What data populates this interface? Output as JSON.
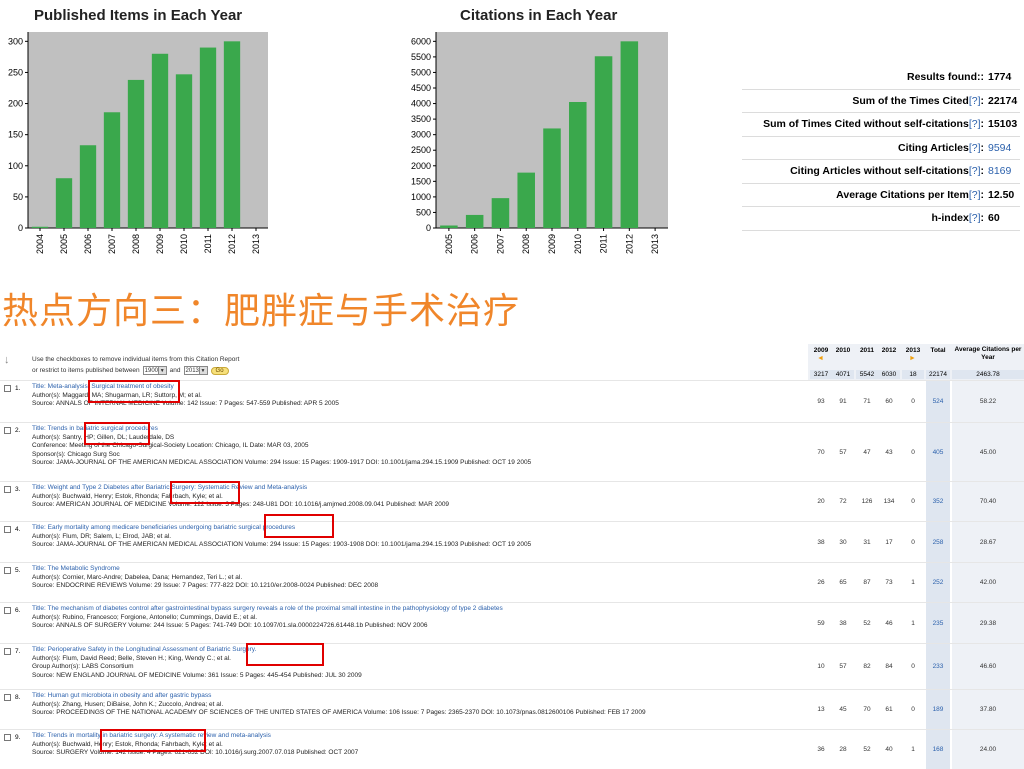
{
  "chart_data": [
    {
      "type": "bar",
      "title": "Published Items in Each Year",
      "categories": [
        "2004",
        "2005",
        "2006",
        "2007",
        "2008",
        "2009",
        "2010",
        "2011",
        "2012",
        "2013"
      ],
      "values": [
        2,
        80,
        133,
        186,
        238,
        280,
        247,
        290,
        300,
        0
      ],
      "yticks": [
        0,
        50,
        100,
        150,
        200,
        250,
        300
      ],
      "ylim": [
        0,
        315
      ],
      "grid": false,
      "colors": {
        "bar": "#3aa84c",
        "plot_bg": "#c0c0c0"
      }
    },
    {
      "type": "bar",
      "title": "Citations in Each Year",
      "categories": [
        "2005",
        "2006",
        "2007",
        "2008",
        "2009",
        "2010",
        "2011",
        "2012",
        "2013"
      ],
      "values": [
        80,
        420,
        960,
        1780,
        3200,
        4050,
        5520,
        6000,
        0
      ],
      "yticks": [
        0,
        500,
        1000,
        1500,
        2000,
        2500,
        3000,
        3500,
        4000,
        4500,
        5000,
        5500,
        6000
      ],
      "ylim": [
        0,
        6300
      ],
      "grid": false,
      "colors": {
        "bar": "#3aa84c",
        "plot_bg": "#c0c0c0"
      }
    }
  ],
  "stats": [
    {
      "label": "Results found:",
      "q": "",
      "value": "1774",
      "link": false
    },
    {
      "label": "Sum of the Times Cited",
      "q": "[?]",
      "value": "22174",
      "link": false
    },
    {
      "label": "Sum of Times Cited without self-citations",
      "q": "[?]",
      "value": "15103",
      "link": false
    },
    {
      "label": "Citing Articles",
      "q": "[?]",
      "value": "9594",
      "link": true
    },
    {
      "label": "Citing Articles without self-citations",
      "q": "[?]",
      "value": "8169",
      "link": true
    },
    {
      "label": "Average Citations per Item",
      "q": "[?]",
      "value": "12.50",
      "link": false
    },
    {
      "label": "h-index",
      "q": "[?]",
      "value": "60",
      "link": false
    }
  ],
  "heading": "热点方向三：肥胖症与手术治疗",
  "report": {
    "note": "Use the checkboxes to remove individual items from this Citation Report",
    "restrict_label": "or restrict to items published between",
    "from_year": "1900",
    "and_label": "and",
    "to_year": "2013",
    "go": "Go",
    "years": [
      "2009",
      "2010",
      "2011",
      "2012",
      "2013"
    ],
    "total_label": "Total",
    "avg_label": "Average Citations per Year",
    "year_totals": [
      "3217",
      "4071",
      "5542",
      "6030",
      "18"
    ],
    "grand_total": "22174",
    "grand_avg": "2463.78"
  },
  "records": [
    {
      "num": "1.",
      "title": "Title: Meta-analysis: Surgical treatment of obesity",
      "lines": [
        "Author(s): Maggard, MA; Shugarman, LR; Suttorp, M; et al.",
        "Source: ANNALS OF INTERNAL MEDICINE  Volume: 142  Issue: 7  Pages: 547-559  Published: APR 5 2005"
      ],
      "cites": [
        "93",
        "91",
        "71",
        "60",
        "0"
      ],
      "total": "524",
      "avg": "58.22"
    },
    {
      "num": "2.",
      "title": "Title: Trends in bariatric surgical procedures",
      "lines": [
        "Author(s): Santry, HP; Gillen, DL; Lauderdale, DS",
        "Conference: Meeting of the Chicago-Surgical-Society  Location: Chicago, IL  Date: MAR 03, 2005",
        "Sponsor(s): Chicago Surg Soc",
        "Source: JAMA-JOURNAL OF THE AMERICAN MEDICAL ASSOCIATION  Volume: 294  Issue: 15  Pages: 1909-1917  DOI: 10.1001/jama.294.15.1909  Published: OCT 19 2005"
      ],
      "cites": [
        "70",
        "57",
        "47",
        "43",
        "0"
      ],
      "total": "405",
      "avg": "45.00"
    },
    {
      "num": "3.",
      "title": "Title: Weight and Type 2 Diabetes after Bariatric Surgery: Systematic Review and Meta-analysis",
      "lines": [
        "Author(s): Buchwald, Henry; Estok, Rhonda; Fahrbach, Kyle; et al.",
        "Source: AMERICAN JOURNAL OF MEDICINE  Volume: 122  Issue: 3  Pages: 248-U81  DOI: 10.1016/j.amjmed.2008.09.041  Published: MAR 2009"
      ],
      "cites": [
        "20",
        "72",
        "126",
        "134",
        "0"
      ],
      "total": "352",
      "avg": "70.40"
    },
    {
      "num": "4.",
      "title": "Title: Early mortality among medicare beneficiaries undergoing bariatric surgical procedures",
      "lines": [
        "Author(s): Flum, DR; Salem, L; Elrod, JAB; et al.",
        "Source: JAMA-JOURNAL OF THE AMERICAN MEDICAL ASSOCIATION  Volume: 294  Issue: 15  Pages: 1903-1908  DOI: 10.1001/jama.294.15.1903  Published: OCT 19 2005"
      ],
      "cites": [
        "38",
        "30",
        "31",
        "17",
        "0"
      ],
      "total": "258",
      "avg": "28.67"
    },
    {
      "num": "5.",
      "title": "Title: The Metabolic Syndrome",
      "lines": [
        "Author(s): Cornier, Marc-Andre; Dabelea, Dana; Hernandez, Teri L.; et al.",
        "Source: ENDOCRINE REVIEWS  Volume: 29  Issue: 7  Pages: 777-822  DOI: 10.1210/er.2008-0024  Published: DEC 2008"
      ],
      "cites": [
        "26",
        "65",
        "87",
        "73",
        "1"
      ],
      "total": "252",
      "avg": "42.00"
    },
    {
      "num": "6.",
      "title": "Title: The mechanism of diabetes control after gastrointestinal bypass surgery reveals a role of the proximal small intestine in the pathophysiology of type 2 diabetes",
      "lines": [
        "Author(s): Rubino, Francesco; Forgione, Antonello; Cummings, David E.; et al.",
        "Source: ANNALS OF SURGERY  Volume: 244  Issue: 5  Pages: 741-749  DOI: 10.1097/01.sla.0000224726.61448.1b  Published: NOV 2006"
      ],
      "cites": [
        "59",
        "38",
        "52",
        "46",
        "1"
      ],
      "total": "235",
      "avg": "29.38"
    },
    {
      "num": "7.",
      "title": "Title: Perioperative Safety in the Longitudinal Assessment of Bariatric Surgery.",
      "lines": [
        "Author(s): Flum, David Reed; Belle, Steven H.; King, Wendy C.; et al.",
        "Group Author(s): LABS Consortium",
        "Source: NEW ENGLAND JOURNAL OF MEDICINE  Volume: 361  Issue: 5  Pages: 445-454  Published: JUL 30 2009"
      ],
      "cites": [
        "10",
        "57",
        "82",
        "84",
        "0"
      ],
      "total": "233",
      "avg": "46.60"
    },
    {
      "num": "8.",
      "title": "Title: Human gut microbiota in obesity and after gastric bypass",
      "lines": [
        "Author(s): Zhang, Husen; DiBaise, John K.; Zuccolo, Andrea; et al.",
        "Source: PROCEEDINGS OF THE NATIONAL ACADEMY OF SCIENCES OF THE UNITED STATES OF AMERICA  Volume: 106  Issue: 7  Pages: 2365-2370  DOI: 10.1073/pnas.0812600106  Published: FEB 17 2009"
      ],
      "cites": [
        "13",
        "45",
        "70",
        "61",
        "0"
      ],
      "total": "189",
      "avg": "37.80"
    },
    {
      "num": "9.",
      "title": "Title: Trends in mortality in bariatric surgery: A systematic review and meta-analysis",
      "lines": [
        "Author(s): Buchwald, Henry; Estok, Rhonda; Fahrbach, Kyle; et al.",
        "Source: SURGERY  Volume: 142  Issue: 4  Pages: 621-632  DOI: 10.1016/j.surg.2007.07.018  Published: OCT 2007"
      ],
      "cites": [
        "36",
        "28",
        "52",
        "40",
        "1"
      ],
      "total": "168",
      "avg": "24.00"
    }
  ]
}
